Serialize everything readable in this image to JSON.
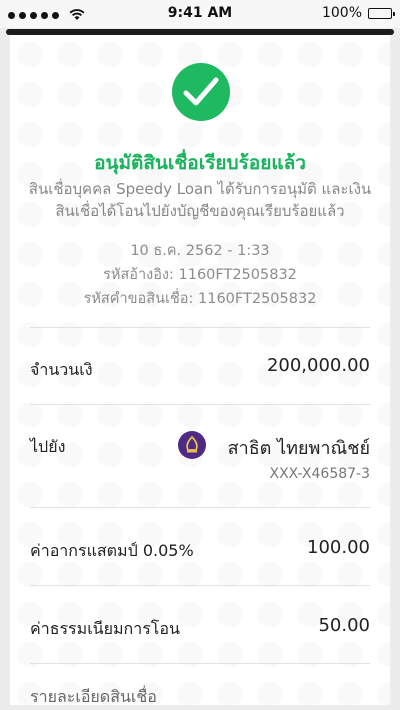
{
  "status_bar": {
    "time": "9:41 AM",
    "battery": "100%"
  },
  "result": {
    "icon": "check-circle-icon",
    "title": "อนุมัติสินเชื่อเรียบร้อยแล้ว",
    "description_line1": "สินเชื่อบุคคล Speedy Loan ได้รับการอนุมัติ และเงิน",
    "description_line2": "สินเชื่อได้โอนไปยังบัญชีของคุณเรียบร้อยแล้ว",
    "datetime": "10 ธ.ค. 2562 - 1:33",
    "reference": "รหัสอ้างอิง: 1160FT2505832",
    "loan_request_id": "รหัสคำขอสินเชื่อ: 1160FT2505832"
  },
  "rows": {
    "amount": {
      "label": "จำนวนเงิ",
      "value": "200,000.00"
    },
    "to": {
      "label": "ไปยัง",
      "bank_name": "สาธิต ไทยพาณิชย์",
      "account": "XXX-X46587-3"
    },
    "stamp_duty": {
      "label": "ค่าอากรแสตมป์ 0.05%",
      "value": "100.00"
    },
    "transfer_fee": {
      "label": "ค่าธรรมเนียมการโอน",
      "value": "50.00"
    }
  },
  "details_label": "รายละเอียดสินเชื่อ",
  "colors": {
    "success": "#1fb961",
    "bank": "#4e2a84"
  }
}
